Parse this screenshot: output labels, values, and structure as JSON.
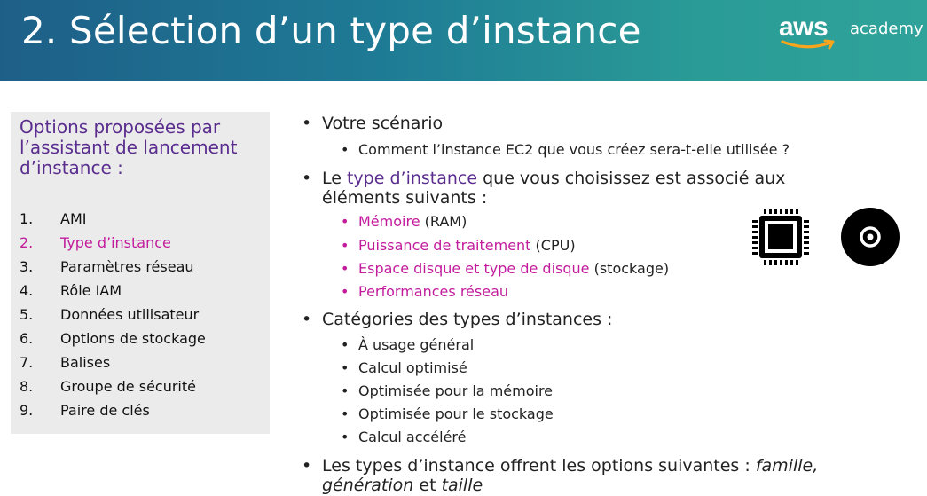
{
  "header": {
    "title": "2. Sélection d’un type d’instance",
    "logo_aws": "aws",
    "logo_academy": "academy"
  },
  "left_panel": {
    "heading": "Options proposées par l’assistant de lancement d’instance :",
    "items": [
      {
        "num": "1.",
        "label": "AMI"
      },
      {
        "num": "2.",
        "label": "Type d’instance",
        "active": true
      },
      {
        "num": "3.",
        "label": "Paramètres réseau"
      },
      {
        "num": "4.",
        "label": "Rôle IAM"
      },
      {
        "num": "5.",
        "label": "Données utilisateur"
      },
      {
        "num": "6.",
        "label": "Options de stockage"
      },
      {
        "num": "7.",
        "label": "Balises"
      },
      {
        "num": "8.",
        "label": "Groupe de sécurité"
      },
      {
        "num": "9.",
        "label": "Paire de clés"
      }
    ]
  },
  "bullets": {
    "scenario": "Votre scénario",
    "scenario_sub": "Comment l’instance EC2 que vous créez sera-t-elle utilisée ?",
    "type_prefix": "Le ",
    "type_highlight": "type d’instance",
    "type_suffix_line1": " que vous choisissez est associé aux",
    "type_suffix_line2": "éléments suivants :",
    "resources": [
      {
        "highlight": "Mémoire",
        "rest": " (RAM)"
      },
      {
        "highlight": "Puissance de traitement",
        "rest": " (CPU)"
      },
      {
        "highlight": "Espace disque et type de disque",
        "rest": " (stockage)"
      },
      {
        "highlight": "Performances réseau",
        "rest": ""
      }
    ],
    "categories": "Catégories des types d’instances :",
    "category_items": [
      "À usage général",
      "Calcul optimisé",
      "Optimisée pour la mémoire",
      "Optimisée pour le stockage",
      "Calcul accéléré"
    ],
    "options_line1": "Les types d’instance offrent les options suivantes : ",
    "options_famille": "famille,",
    "options_generation": "génération",
    "options_et": " et ",
    "options_taille": "taille"
  },
  "icons": [
    "cpu-chip-icon",
    "disc-icon"
  ],
  "colors": {
    "accent_pink": "#c21c9c",
    "accent_purple": "#5a2d8e",
    "header_teal": "#2a9b97"
  }
}
